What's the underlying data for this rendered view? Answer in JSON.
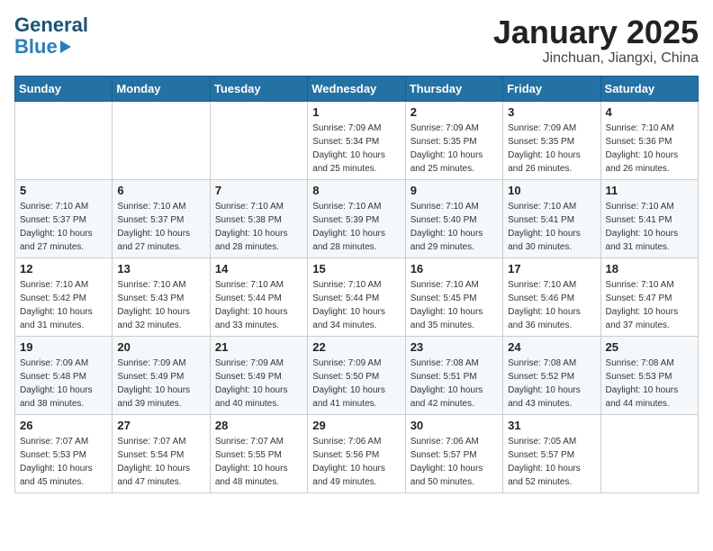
{
  "header": {
    "logo_general": "General",
    "logo_blue": "Blue",
    "month_title": "January 2025",
    "location": "Jinchuan, Jiangxi, China"
  },
  "days_of_week": [
    "Sunday",
    "Monday",
    "Tuesday",
    "Wednesday",
    "Thursday",
    "Friday",
    "Saturday"
  ],
  "weeks": [
    [
      {
        "day": "",
        "sunrise": "",
        "sunset": "",
        "daylight": ""
      },
      {
        "day": "",
        "sunrise": "",
        "sunset": "",
        "daylight": ""
      },
      {
        "day": "",
        "sunrise": "",
        "sunset": "",
        "daylight": ""
      },
      {
        "day": "1",
        "sunrise": "Sunrise: 7:09 AM",
        "sunset": "Sunset: 5:34 PM",
        "daylight": "Daylight: 10 hours and 25 minutes."
      },
      {
        "day": "2",
        "sunrise": "Sunrise: 7:09 AM",
        "sunset": "Sunset: 5:35 PM",
        "daylight": "Daylight: 10 hours and 25 minutes."
      },
      {
        "day": "3",
        "sunrise": "Sunrise: 7:09 AM",
        "sunset": "Sunset: 5:35 PM",
        "daylight": "Daylight: 10 hours and 26 minutes."
      },
      {
        "day": "4",
        "sunrise": "Sunrise: 7:10 AM",
        "sunset": "Sunset: 5:36 PM",
        "daylight": "Daylight: 10 hours and 26 minutes."
      }
    ],
    [
      {
        "day": "5",
        "sunrise": "Sunrise: 7:10 AM",
        "sunset": "Sunset: 5:37 PM",
        "daylight": "Daylight: 10 hours and 27 minutes."
      },
      {
        "day": "6",
        "sunrise": "Sunrise: 7:10 AM",
        "sunset": "Sunset: 5:37 PM",
        "daylight": "Daylight: 10 hours and 27 minutes."
      },
      {
        "day": "7",
        "sunrise": "Sunrise: 7:10 AM",
        "sunset": "Sunset: 5:38 PM",
        "daylight": "Daylight: 10 hours and 28 minutes."
      },
      {
        "day": "8",
        "sunrise": "Sunrise: 7:10 AM",
        "sunset": "Sunset: 5:39 PM",
        "daylight": "Daylight: 10 hours and 28 minutes."
      },
      {
        "day": "9",
        "sunrise": "Sunrise: 7:10 AM",
        "sunset": "Sunset: 5:40 PM",
        "daylight": "Daylight: 10 hours and 29 minutes."
      },
      {
        "day": "10",
        "sunrise": "Sunrise: 7:10 AM",
        "sunset": "Sunset: 5:41 PM",
        "daylight": "Daylight: 10 hours and 30 minutes."
      },
      {
        "day": "11",
        "sunrise": "Sunrise: 7:10 AM",
        "sunset": "Sunset: 5:41 PM",
        "daylight": "Daylight: 10 hours and 31 minutes."
      }
    ],
    [
      {
        "day": "12",
        "sunrise": "Sunrise: 7:10 AM",
        "sunset": "Sunset: 5:42 PM",
        "daylight": "Daylight: 10 hours and 31 minutes."
      },
      {
        "day": "13",
        "sunrise": "Sunrise: 7:10 AM",
        "sunset": "Sunset: 5:43 PM",
        "daylight": "Daylight: 10 hours and 32 minutes."
      },
      {
        "day": "14",
        "sunrise": "Sunrise: 7:10 AM",
        "sunset": "Sunset: 5:44 PM",
        "daylight": "Daylight: 10 hours and 33 minutes."
      },
      {
        "day": "15",
        "sunrise": "Sunrise: 7:10 AM",
        "sunset": "Sunset: 5:44 PM",
        "daylight": "Daylight: 10 hours and 34 minutes."
      },
      {
        "day": "16",
        "sunrise": "Sunrise: 7:10 AM",
        "sunset": "Sunset: 5:45 PM",
        "daylight": "Daylight: 10 hours and 35 minutes."
      },
      {
        "day": "17",
        "sunrise": "Sunrise: 7:10 AM",
        "sunset": "Sunset: 5:46 PM",
        "daylight": "Daylight: 10 hours and 36 minutes."
      },
      {
        "day": "18",
        "sunrise": "Sunrise: 7:10 AM",
        "sunset": "Sunset: 5:47 PM",
        "daylight": "Daylight: 10 hours and 37 minutes."
      }
    ],
    [
      {
        "day": "19",
        "sunrise": "Sunrise: 7:09 AM",
        "sunset": "Sunset: 5:48 PM",
        "daylight": "Daylight: 10 hours and 38 minutes."
      },
      {
        "day": "20",
        "sunrise": "Sunrise: 7:09 AM",
        "sunset": "Sunset: 5:49 PM",
        "daylight": "Daylight: 10 hours and 39 minutes."
      },
      {
        "day": "21",
        "sunrise": "Sunrise: 7:09 AM",
        "sunset": "Sunset: 5:49 PM",
        "daylight": "Daylight: 10 hours and 40 minutes."
      },
      {
        "day": "22",
        "sunrise": "Sunrise: 7:09 AM",
        "sunset": "Sunset: 5:50 PM",
        "daylight": "Daylight: 10 hours and 41 minutes."
      },
      {
        "day": "23",
        "sunrise": "Sunrise: 7:08 AM",
        "sunset": "Sunset: 5:51 PM",
        "daylight": "Daylight: 10 hours and 42 minutes."
      },
      {
        "day": "24",
        "sunrise": "Sunrise: 7:08 AM",
        "sunset": "Sunset: 5:52 PM",
        "daylight": "Daylight: 10 hours and 43 minutes."
      },
      {
        "day": "25",
        "sunrise": "Sunrise: 7:08 AM",
        "sunset": "Sunset: 5:53 PM",
        "daylight": "Daylight: 10 hours and 44 minutes."
      }
    ],
    [
      {
        "day": "26",
        "sunrise": "Sunrise: 7:07 AM",
        "sunset": "Sunset: 5:53 PM",
        "daylight": "Daylight: 10 hours and 45 minutes."
      },
      {
        "day": "27",
        "sunrise": "Sunrise: 7:07 AM",
        "sunset": "Sunset: 5:54 PM",
        "daylight": "Daylight: 10 hours and 47 minutes."
      },
      {
        "day": "28",
        "sunrise": "Sunrise: 7:07 AM",
        "sunset": "Sunset: 5:55 PM",
        "daylight": "Daylight: 10 hours and 48 minutes."
      },
      {
        "day": "29",
        "sunrise": "Sunrise: 7:06 AM",
        "sunset": "Sunset: 5:56 PM",
        "daylight": "Daylight: 10 hours and 49 minutes."
      },
      {
        "day": "30",
        "sunrise": "Sunrise: 7:06 AM",
        "sunset": "Sunset: 5:57 PM",
        "daylight": "Daylight: 10 hours and 50 minutes."
      },
      {
        "day": "31",
        "sunrise": "Sunrise: 7:05 AM",
        "sunset": "Sunset: 5:57 PM",
        "daylight": "Daylight: 10 hours and 52 minutes."
      },
      {
        "day": "",
        "sunrise": "",
        "sunset": "",
        "daylight": ""
      }
    ]
  ]
}
